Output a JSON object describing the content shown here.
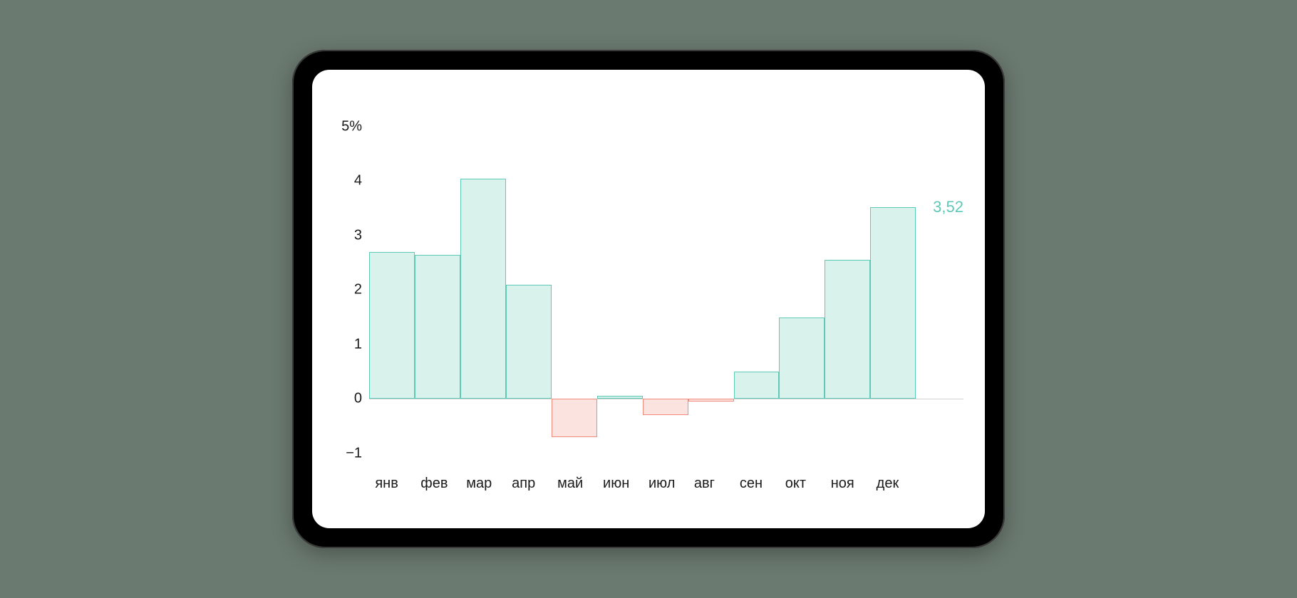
{
  "chart_data": {
    "type": "bar",
    "categories": [
      "янв",
      "фев",
      "мар",
      "апр",
      "май",
      "июн",
      "июл",
      "авг",
      "сен",
      "окт",
      "ноя",
      "дек"
    ],
    "values": [
      2.7,
      2.65,
      4.05,
      2.1,
      -0.7,
      0.05,
      -0.3,
      -0.05,
      0.5,
      1.5,
      2.55,
      3.52
    ],
    "ylim": [
      -1.2,
      5.0
    ],
    "y_ticks": [
      5,
      4,
      3,
      2,
      1,
      0,
      -1
    ],
    "y_tick_labels": [
      "5%",
      "4",
      "3",
      "2",
      "1",
      "0",
      "−1"
    ],
    "end_label": "3,52",
    "colors": {
      "positive_fill": "#d9f2ec",
      "positive_stroke": "#5fc9b8",
      "negative_fill": "#fbe3e0",
      "negative_stroke": "#f08a7a"
    }
  }
}
